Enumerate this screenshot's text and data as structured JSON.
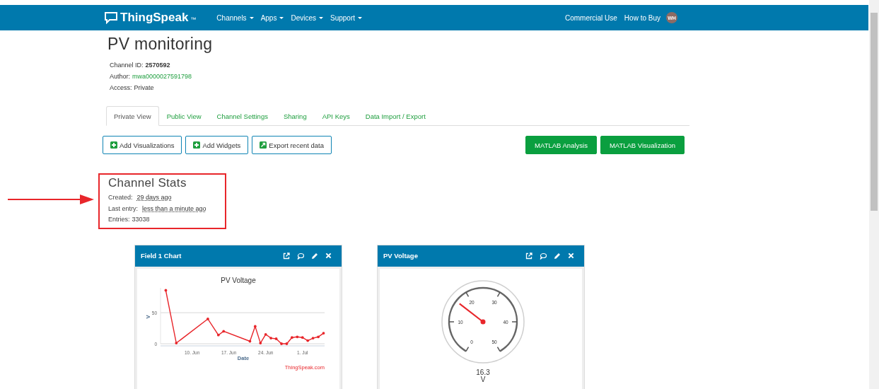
{
  "navbar": {
    "logo": "ThingSpeak",
    "trademark": "™",
    "menus": [
      {
        "label": "Channels"
      },
      {
        "label": "Apps"
      },
      {
        "label": "Devices"
      },
      {
        "label": "Support"
      }
    ],
    "links": [
      "Commercial Use",
      "How to Buy"
    ],
    "avatar": "WH"
  },
  "channel": {
    "title": "PV monitoring",
    "meta": [
      {
        "label": "Channel ID:",
        "value": "2570592",
        "kind": "bold"
      },
      {
        "label": "Author:",
        "value": "mwa0000027591798",
        "kind": "link"
      },
      {
        "label": "Access:",
        "value": "Private",
        "kind": "plain"
      }
    ]
  },
  "tabs": [
    {
      "label": "Private View",
      "selected": true
    },
    {
      "label": "Public View",
      "selected": false
    },
    {
      "label": "Channel Settings",
      "selected": false
    },
    {
      "label": "Sharing",
      "selected": false
    },
    {
      "label": "API Keys",
      "selected": false
    },
    {
      "label": "Data Import / Export",
      "selected": false
    }
  ],
  "actions": [
    {
      "label": "Add Visualizations",
      "kind": "add"
    },
    {
      "label": "Add Widgets",
      "kind": "add"
    },
    {
      "label": "Export recent data",
      "kind": "export"
    },
    {
      "label": "MATLAB Analysis",
      "kind": "solid"
    },
    {
      "label": "MATLAB Visualization",
      "kind": "solid"
    }
  ],
  "stats": {
    "title": "Channel Stats",
    "rows": [
      {
        "label": "Created:",
        "value": "29 days ago",
        "kind": "link"
      },
      {
        "label": "Last entry:",
        "value": "less than a minute ago",
        "kind": "link"
      },
      {
        "label": "Entries:",
        "value": "33038",
        "kind": "plain"
      }
    ]
  },
  "widgets": [
    {
      "kind": "chart",
      "title": "Field 1 Chart",
      "credit": "ThingSpeak.com",
      "chart_data": {
        "type": "line",
        "title": "PV Voltage",
        "xlabel": "Date",
        "ylabel": "V",
        "categories": [
          null,
          null,
          null,
          null,
          null,
          "10. Jun",
          null,
          null,
          null,
          null,
          null,
          null,
          "17. Jun",
          null,
          null,
          null,
          null,
          null,
          null,
          "24. Jun",
          null,
          null,
          null,
          null,
          null,
          null,
          "1. Jul",
          null,
          null,
          null,
          null
        ],
        "series": [
          {
            "color": "#e8262b",
            "values": [
              86,
              null,
              1,
              null,
              null,
              null,
              null,
              null,
              40,
              null,
              14,
              20,
              null,
              null,
              null,
              null,
              4,
              28,
              1,
              15,
              9,
              8,
              0,
              0,
              10,
              11,
              10,
              5,
              9,
              11,
              17
            ]
          }
        ],
        "ylim": [
          0,
          90
        ],
        "yticks": [
          0,
          50
        ]
      }
    },
    {
      "kind": "gauge",
      "title": "PV Voltage",
      "gauge": {
        "ticks": [
          "0",
          "10",
          "20",
          "30",
          "40",
          "50"
        ],
        "reading": "16.3",
        "unit": "V"
      }
    }
  ]
}
